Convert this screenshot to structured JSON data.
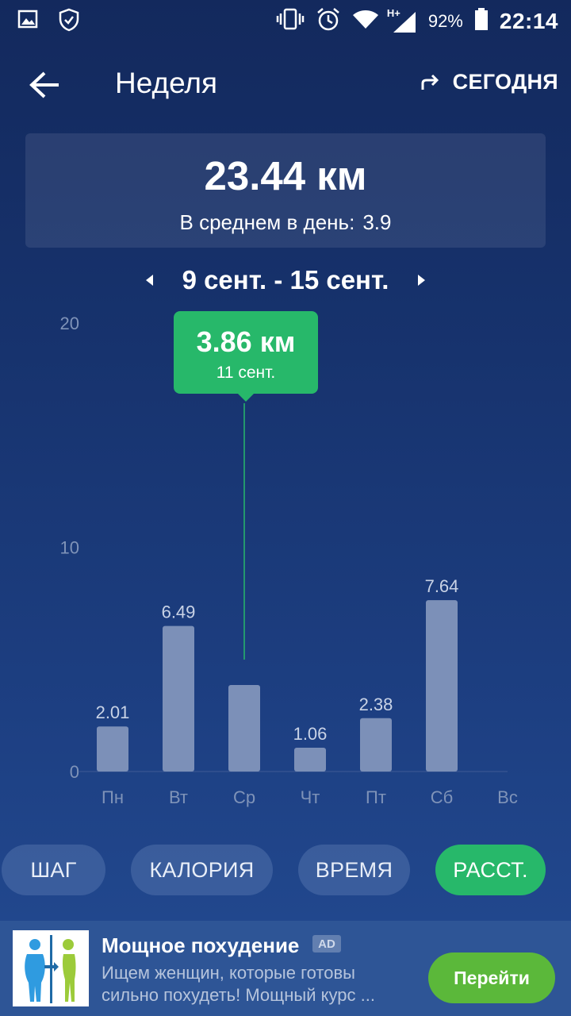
{
  "status_bar": {
    "time": "22:14",
    "battery_percent": "92%",
    "network_label": "H+",
    "icons": [
      "gallery-icon",
      "shield-check-icon",
      "vibrate-icon",
      "alarm-icon",
      "wifi-icon",
      "signal-icon",
      "battery-icon"
    ]
  },
  "header": {
    "title": "Неделя",
    "today_label": "СЕГОДНЯ"
  },
  "summary": {
    "total": "23.44 км",
    "avg_label": "В среднем в день:",
    "avg_value": "3.9"
  },
  "week": {
    "range": "9 сент. - 15 сент."
  },
  "tooltip": {
    "value": "3.86 км",
    "date": "11 сент."
  },
  "chart_data": {
    "type": "bar",
    "categories": [
      "Пн",
      "Вт",
      "Ср",
      "Чт",
      "Пт",
      "Сб",
      "Вс"
    ],
    "values": [
      2.01,
      6.49,
      3.86,
      1.06,
      2.38,
      7.64,
      0
    ],
    "value_labels": [
      "2.01",
      "6.49",
      "",
      "1.06",
      "2.38",
      "7.64",
      ""
    ],
    "y_ticks": [
      "0",
      "10",
      "20"
    ],
    "ylim": [
      0,
      20
    ],
    "highlighted_index": 2,
    "bar_color": "#7c90b8",
    "highlight_color": "#27b86a"
  },
  "metric_tabs": [
    {
      "label": "ШАГ",
      "active": false
    },
    {
      "label": "КАЛОРИЯ",
      "active": false
    },
    {
      "label": "ВРЕМЯ",
      "active": false
    },
    {
      "label": "РАССТ.",
      "active": true
    }
  ],
  "ad": {
    "title": "Мощное похудение",
    "badge": "AD",
    "text": "Ищем женщин, которые готовы сильно похудеть! Мощный курс ...",
    "button_label": "Перейти"
  }
}
